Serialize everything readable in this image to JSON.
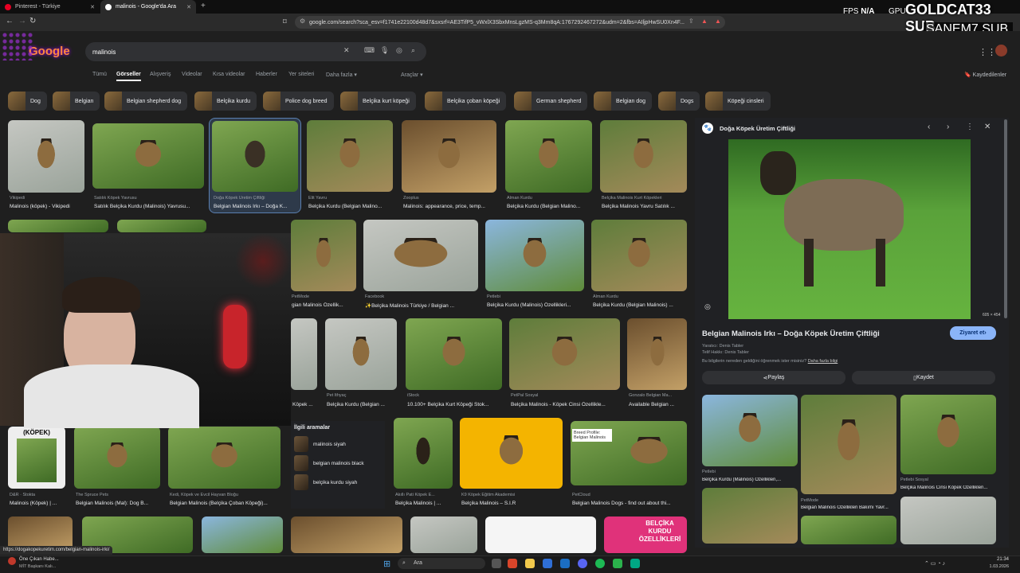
{
  "browser": {
    "tabs": [
      {
        "label": "Pinterest - Türkiye"
      },
      {
        "label": "malinois - Google'da Ara"
      }
    ],
    "url": "google.com/search?sca_esv=f1741e22100d48d7&sxsrf=AE3TifP5_vWxlX3SbxMnsLgzMS-q3Mm8qA:1767292467272&udm=2&fbs=AIljpHwSU0Xn4F..."
  },
  "overlay": {
    "fps_label": "FPS",
    "fps_value": "N/A",
    "gpu_label": "GPU",
    "line1": "GOLDCAT33 SUB",
    "line2": "SANEM7 SUB"
  },
  "google": {
    "logo": "Google",
    "query": "malinois",
    "nav": [
      "Tümü",
      "Görseller",
      "Alışveriş",
      "Videolar",
      "Kısa videolar",
      "Haberler",
      "Yer siteleri",
      "Daha fazla ▾"
    ],
    "tools": "Araçlar ▾",
    "saved": "Kaydedilenler",
    "chips": [
      "Dog",
      "Belgian",
      "Belgian shepherd dog",
      "Belçika kurdu",
      "Police dog breed",
      "Belçika kurt köpeği",
      "Belçika çoban köpeği",
      "German shepherd",
      "Belgian dog",
      "Dogs",
      "Köpeği cinsleri"
    ]
  },
  "results_row1": [
    {
      "src": "Vikipedi",
      "title": "Malinois (köpek) - Vikipedi"
    },
    {
      "src": "Satılık Köpek Yavrusu",
      "title": "Satılık Belçika Kurdu (Malinois) Yavrusu..."
    },
    {
      "src": "Doğa Köpek Üretim Çiftliği",
      "title": "Belgian Malinois Irkı – Doğa K..."
    },
    {
      "src": "Elit Yavru",
      "title": "Belçika Kurdu (Belgian Malino..."
    },
    {
      "src": "Zooplus",
      "title": "Malinois: appearance, price, temp..."
    },
    {
      "src": "Alman Kurdu",
      "title": "Belçika Kurdu (Belgian Malino..."
    },
    {
      "src": "Belçika Malinois Kurt Köpekleri",
      "title": "Belçika Malinois Yavru Satılık ..."
    }
  ],
  "results_row2": [
    {
      "src": "PetMode",
      "title": "gian Malinois Özellik..."
    },
    {
      "src": "Facebook",
      "title": "✨Belçika Malinois Türkiye / Belgian ..."
    },
    {
      "src": "Petlebi",
      "title": "Belçika Kurdu (Malinois) Özellikleri..."
    },
    {
      "src": "Alman Kurdu",
      "title": "Belçika Kurdu (Belgian Malinois) ..."
    }
  ],
  "results_row3": [
    {
      "src": "",
      "title": "Köpek ..."
    },
    {
      "src": "Pet İthyaç",
      "title": "Belçika Kurdu (Belgian ..."
    },
    {
      "src": "iStock",
      "title": "10.100+ Belçika Kurt Köpeği Stok..."
    },
    {
      "src": "PetPal Sosyal",
      "title": "Belçika Malinois - Köpek Cinsi Özellikle..."
    },
    {
      "src": "Gonzalo Belgian Ma...",
      "title": "Available Belgian ..."
    }
  ],
  "results_row4": [
    {
      "src": "D&R · Stokta",
      "title": "Malinois (Köpek) | ...",
      "badge": "(KÖPEK)"
    },
    {
      "src": "The Spruce Pets",
      "title": "Belgian Malinois (Mal): Dog B..."
    },
    {
      "src": "Kedi, Köpek ve Evcil Hayvan Bloğu",
      "title": "Belgian Malinois (Belçika Çoban Köpeği)..."
    },
    {
      "src": "Akıllı Pati Köpek E...",
      "title": "Belçika Malinois | ..."
    },
    {
      "src": "K9 Köpek Eğitim Akademisi",
      "title": "Belçika Malinois – S.I.R"
    },
    {
      "src": "PetCloud",
      "title": "Belgian Malinois Dogs - find out about thi...",
      "badge": "Breed Profile: Belgian Malinois"
    }
  ],
  "related": {
    "title": "İlgili aramalar",
    "items": [
      "malinois siyah",
      "belgian malinois black",
      "belçika kurdu siyah"
    ]
  },
  "bottom_badge": "BELÇİKA KURDU ÖZELLİKLERİ",
  "panel": {
    "site": "Doğa Köpek Üretim Çiftliği",
    "size": "605 × 454",
    "title": "Belgian Malinois Irkı – Doğa Köpek Üretim Çiftliği",
    "visit": "Ziyaret et",
    "author": "Yaratıcı: Denis Tabler",
    "rights": "Telif Hakkı: Denis Tabler",
    "info": "Bu bilgilerin nereden geldiğini öğrenmek ister misiniz?",
    "info_link": "Daha fazla bilgi",
    "share": "Paylaş",
    "save": "Kaydet",
    "related": [
      {
        "src": "Petlebi",
        "title": "Belçika Kurdu (Malinois) Özellikleri,..."
      },
      {
        "src": "PetMode",
        "title": "Belgian Malinois Özellikleri Bakımı Yavr..."
      },
      {
        "src": "Petlebi Sosyal",
        "title": "Belçika Malinois Cinsi Köpek Özellikleri..."
      }
    ]
  },
  "status": {
    "link": "https://dogakopekuretim.com/belgian-malinois-irki/",
    "news_title": "Öne Çıkan Habe...",
    "news_sub": "MİT Başkanı Kalı...",
    "search": "Ara",
    "time": "21:34",
    "date": "1.03.2026"
  }
}
